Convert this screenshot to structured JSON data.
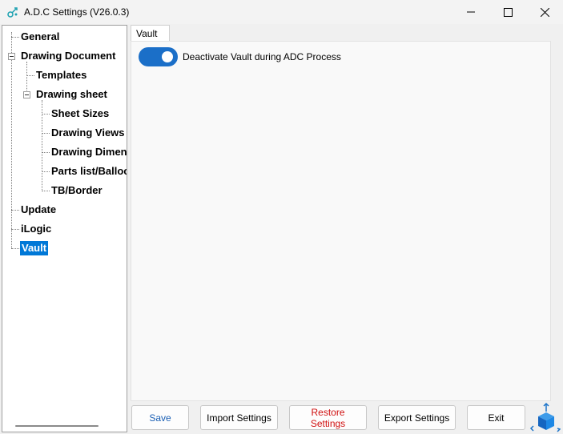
{
  "window": {
    "title": "A.D.C Settings (V26.0.3)"
  },
  "tree": [
    {
      "key": "general",
      "label": "General"
    },
    {
      "key": "drawing-document",
      "label": "Drawing Document"
    },
    {
      "key": "templates",
      "label": "Templates"
    },
    {
      "key": "drawing-sheet",
      "label": "Drawing sheet"
    },
    {
      "key": "sheet-sizes",
      "label": "Sheet Sizes"
    },
    {
      "key": "drawing-views",
      "label": "Drawing Views"
    },
    {
      "key": "drawing-dimensions",
      "label": "Drawing Dimens"
    },
    {
      "key": "parts-list",
      "label": "Parts list/Balloo"
    },
    {
      "key": "tb-border",
      "label": "TB/Border"
    },
    {
      "key": "update",
      "label": "Update"
    },
    {
      "key": "ilogic",
      "label": "iLogic"
    },
    {
      "key": "vault",
      "label": "Vault"
    }
  ],
  "tab": {
    "label": "Vault"
  },
  "vault": {
    "toggle_label": "Deactivate Vault during ADC Process",
    "toggle_on": true
  },
  "buttons": {
    "save": "Save",
    "import": "Import Settings",
    "restore": "Restore Settings",
    "export": "Export Settings",
    "exit": "Exit"
  },
  "colors": {
    "accent": "#0078d7",
    "toggle": "#1b6fc8",
    "save_text": "#1a5fb4",
    "restore_text": "#d01010"
  }
}
